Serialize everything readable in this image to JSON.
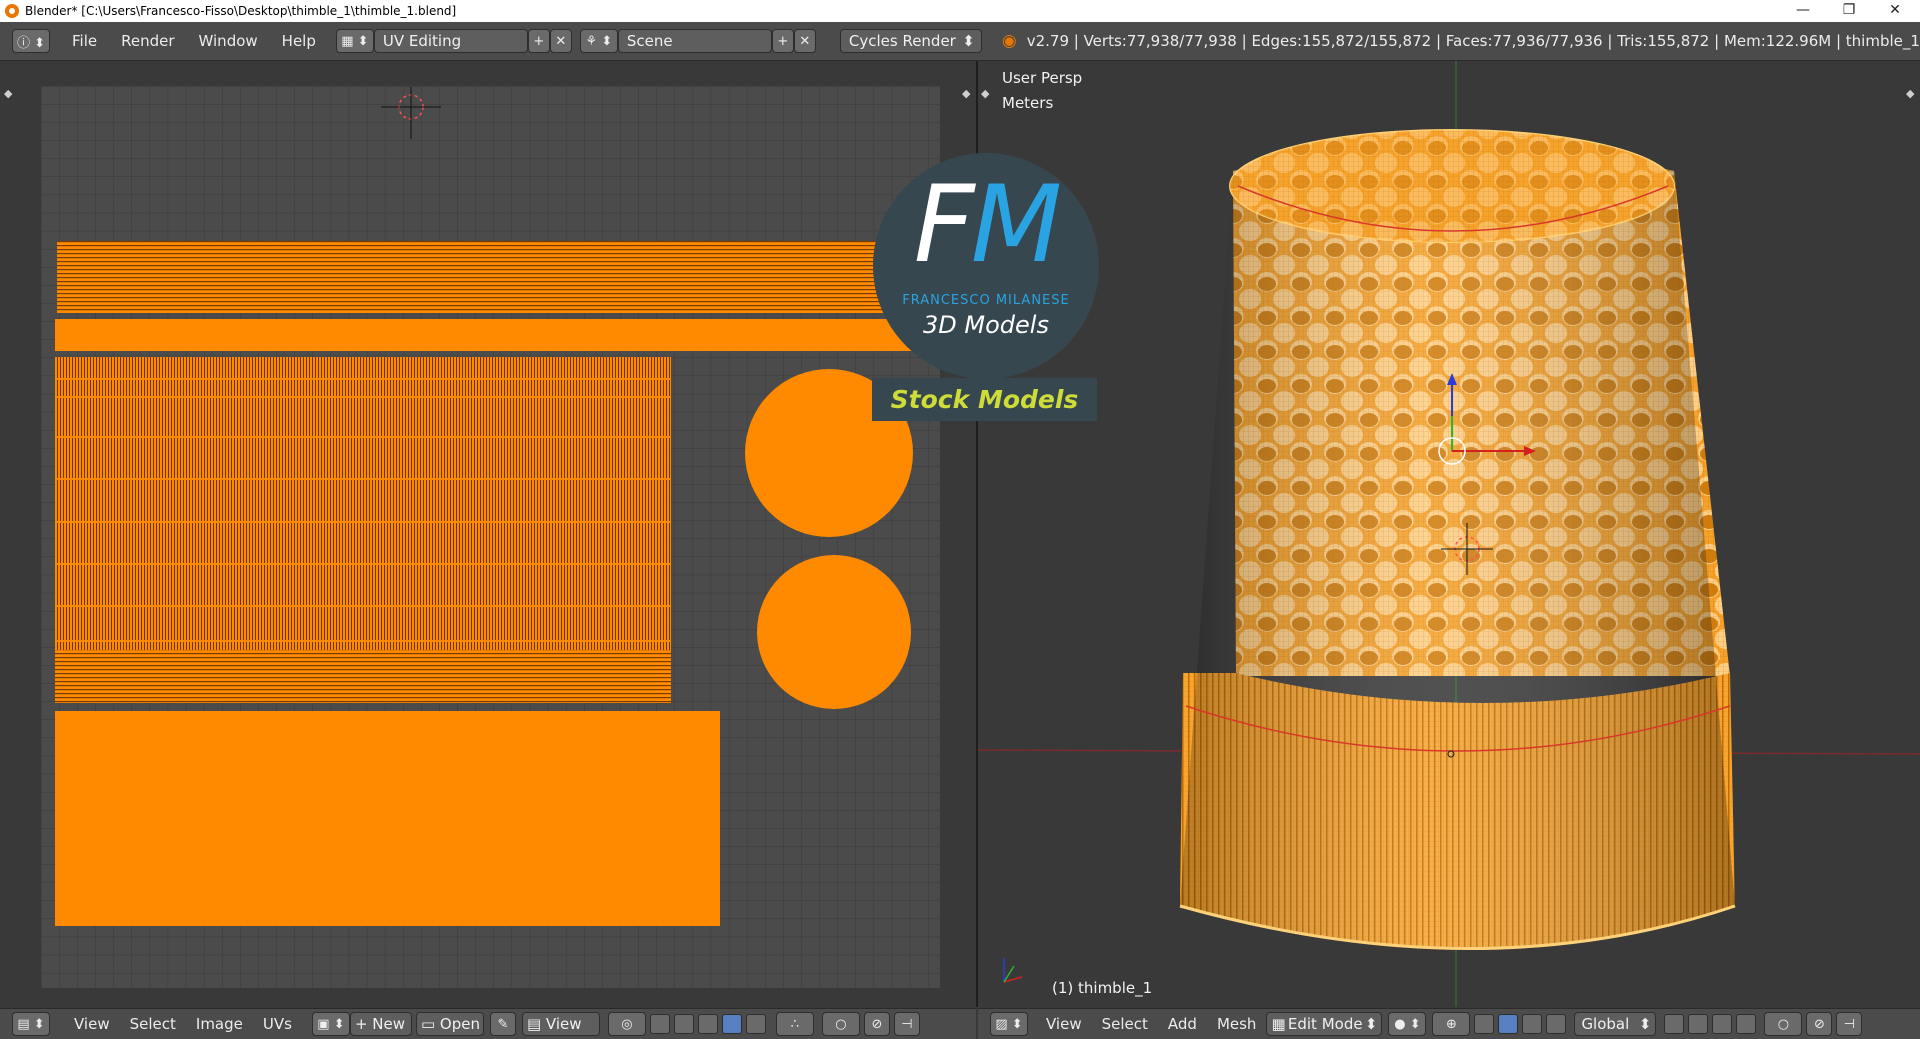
{
  "window": {
    "title": "Blender* [C:\\Users\\Francesco-Fisso\\Desktop\\thimble_1\\thimble_1.blend]",
    "minimize": "—",
    "maximize": "❐",
    "close": "✕"
  },
  "info_header": {
    "menus": [
      "File",
      "Render",
      "Window",
      "Help"
    ],
    "layout": "UV Editing",
    "scene": "Scene",
    "engine": "Cycles Render",
    "stats": "v2.79 | Verts:77,938/77,938 | Edges:155,872/155,872 | Faces:77,936/77,936 | Tris:155,872 | Mem:122.96M | thimble_1"
  },
  "viewport": {
    "perspective": "User Persp",
    "units": "Meters",
    "object_label": "(1) thimble_1"
  },
  "uv_header": {
    "menus": [
      "View",
      "Select",
      "Image",
      "UVs"
    ],
    "new_label": "New",
    "open_label": "Open",
    "view_label": "View"
  },
  "view3d_header": {
    "menus": [
      "View",
      "Select",
      "Add",
      "Mesh"
    ],
    "mode": "Edit Mode",
    "orientation": "Global"
  },
  "watermark": {
    "letter_f": "F",
    "letter_m": "M",
    "name": "FRANCESCO MILANESE",
    "subtitle": "3D Models",
    "banner": "Stock Models"
  },
  "colors": {
    "uv_orange": "#ff8a00",
    "mesh_orange": "#f7a531",
    "logo_blue": "#29a3e1",
    "banner_green": "#cddc39"
  },
  "icons": [
    "info-icon",
    "layout-icon",
    "scene-icon",
    "blender-icon",
    "editor-type-icon",
    "image-icon",
    "pin-icon",
    "cube-icon",
    "sphere-icon",
    "vertex-select-icon",
    "edge-select-icon",
    "face-select-icon"
  ]
}
